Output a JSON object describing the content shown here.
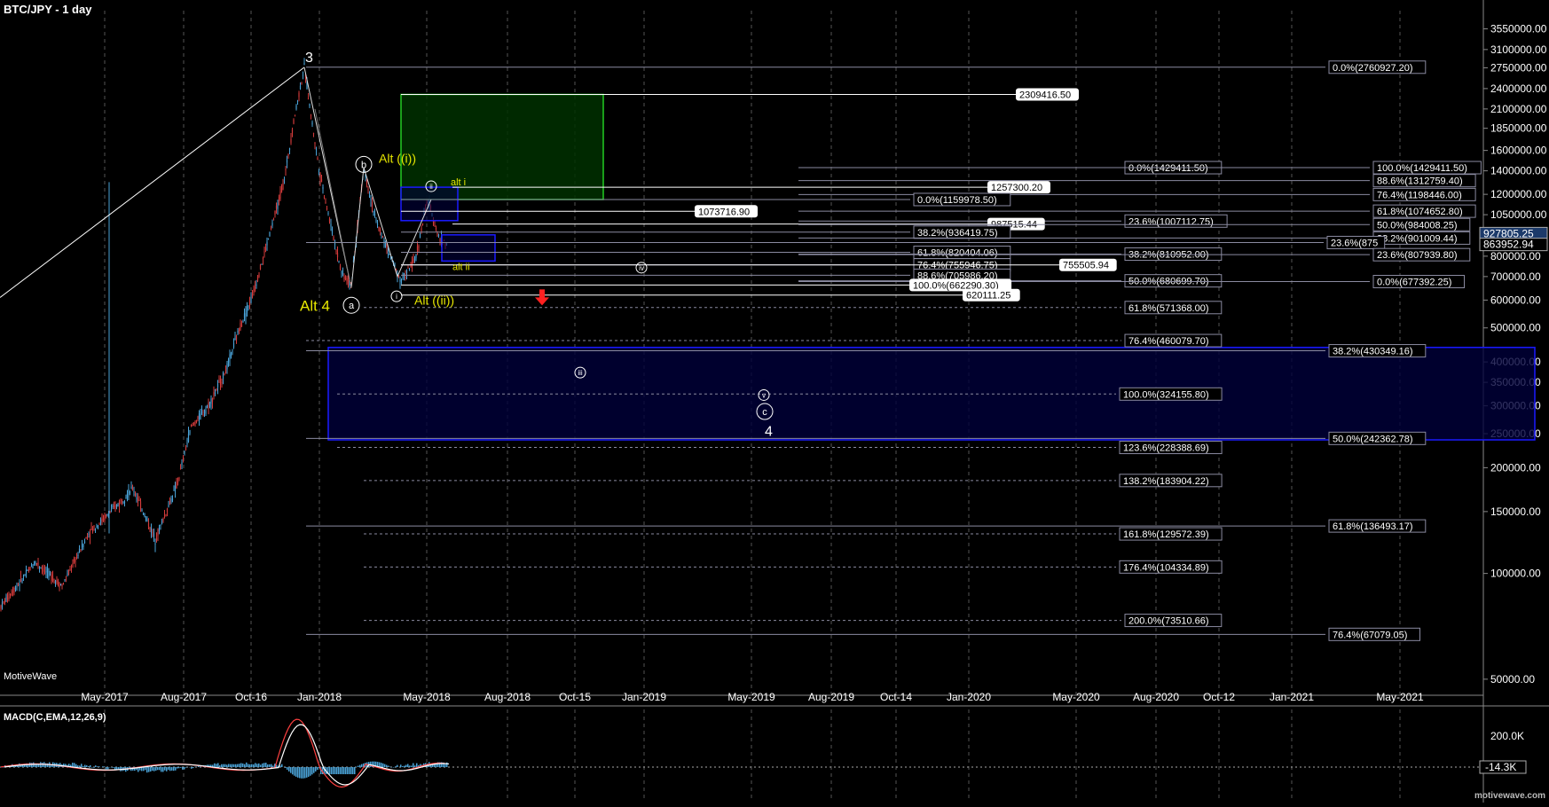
{
  "chart": {
    "title": "BTC/JPY - 1 day",
    "brand": "MotiveWave",
    "brand_footer": "motivewave.com",
    "macd_title": "MACD(C,EMA,12,26,9)",
    "colors": {
      "background": "#000000",
      "grid": "#555555",
      "up": "#4aa3d8",
      "down": "#d43b3b",
      "green_box": "#22cc22",
      "blue_box": "#1a1aff",
      "wave_label": "#ffffff",
      "alt_label": "#e8e800",
      "arrow": "#ff2020"
    }
  },
  "chart_data": {
    "type": "candlestick",
    "y_scale": "log",
    "ylim": [
      45000,
      4000000
    ],
    "x_ticks": [
      "May-2017",
      "Aug-2017",
      "Oct-16",
      "Jan-2018",
      "May-2018",
      "Aug-2018",
      "Oct-15",
      "Jan-2019",
      "May-2019",
      "Aug-2019",
      "Oct-14",
      "Jan-2020",
      "May-2020",
      "Aug-2020",
      "Oct-12",
      "Jan-2021",
      "May-2021"
    ],
    "y_ticks": [
      "3550000.00",
      "3100000.00",
      "2750000.00",
      "2400000.00",
      "2100000.00",
      "1850000.00",
      "1600000.00",
      "1400000.00",
      "1200000.00",
      "1050000.00",
      "800000.00",
      "700000.00",
      "600000.00",
      "500000.00",
      "400000.00",
      "350000.00",
      "300000.00",
      "250000.00",
      "200000.00",
      "150000.00",
      "100000.00",
      "50000.00"
    ],
    "price_labels": [
      "927805.25",
      "863952.94"
    ],
    "level_labels": [
      {
        "text": "0.0%(2760927.20)",
        "value": 2760927.2
      },
      {
        "text": "2309416.50",
        "value": 2309416.5
      },
      {
        "text": "0.0%(1429411.50)",
        "value": 1429411.5
      },
      {
        "text": "100.0%(1429411.50)",
        "value": 1429411.5
      },
      {
        "text": "88.6%(1312759.40)",
        "value": 1312759.4
      },
      {
        "text": "1257300.20",
        "value": 1257300.2
      },
      {
        "text": "76.4%(1198446.00)",
        "value": 1198446.0
      },
      {
        "text": "0.0%(1159978.50)",
        "value": 1159978.5
      },
      {
        "text": "1073716.90",
        "value": 1073716.9
      },
      {
        "text": "61.8%(1074652.80)",
        "value": 1074652.8
      },
      {
        "text": "23.6%(1007112.75)",
        "value": 1007112.75
      },
      {
        "text": "987515.44",
        "value": 987515.44
      },
      {
        "text": "50.0%(984008.25)",
        "value": 984008.25
      },
      {
        "text": "38.2%(936419.75)",
        "value": 936419.75
      },
      {
        "text": "38.2%(901009.44)",
        "value": 901009.44
      },
      {
        "text": "23.6%(875",
        "value": 875000
      },
      {
        "text": "61.8%(820404.06)",
        "value": 820404.06
      },
      {
        "text": "38.2%(810952.00)",
        "value": 810952.0
      },
      {
        "text": "23.6%(807939.80)",
        "value": 807939.8
      },
      {
        "text": "76.4%(755946.75)",
        "value": 755946.75
      },
      {
        "text": "755505.94",
        "value": 755505.94
      },
      {
        "text": "88.6%(705986.20)",
        "value": 705986.2
      },
      {
        "text": "50.0%(680699.70)",
        "value": 680699.7
      },
      {
        "text": "0.0%(677392.25)",
        "value": 677392.25
      },
      {
        "text": "100.0%(662290.30)",
        "value": 662290.3
      },
      {
        "text": "620111.25",
        "value": 620111.25
      },
      {
        "text": "61.8%(571368.00)",
        "value": 571368.0
      },
      {
        "text": "76.4%(460079.70)",
        "value": 460079.7
      },
      {
        "text": "38.2%(430349.16)",
        "value": 430349.16
      },
      {
        "text": "100.0%(324155.80)",
        "value": 324155.8
      },
      {
        "text": "50.0%(242362.78)",
        "value": 242362.78
      },
      {
        "text": "123.6%(228388.69)",
        "value": 228388.69
      },
      {
        "text": "138.2%(183904.22)",
        "value": 183904.22
      },
      {
        "text": "61.8%(136493.17)",
        "value": 136493.17
      },
      {
        "text": "161.8%(129572.39)",
        "value": 129572.39
      },
      {
        "text": "176.4%(104334.89)",
        "value": 104334.89
      },
      {
        "text": "200.0%(73510.66)",
        "value": 73510.66
      },
      {
        "text": "76.4%(67079.05)",
        "value": 67079.05
      }
    ],
    "wave_labels": [
      {
        "text": "3",
        "color": "white"
      },
      {
        "text": "b",
        "circled": true
      },
      {
        "text": "Alt ((i))",
        "color": "yellow"
      },
      {
        "text": "ii",
        "circled": true
      },
      {
        "text": "alt i",
        "color": "yellow"
      },
      {
        "text": "alt ii",
        "color": "yellow"
      },
      {
        "text": "iv",
        "circled": true
      },
      {
        "text": "i",
        "circled": true
      },
      {
        "text": "Alt ((ii))",
        "color": "yellow"
      },
      {
        "text": "Alt 4",
        "color": "yellow"
      },
      {
        "text": "a",
        "circled": true
      },
      {
        "text": "iii",
        "circled": true
      },
      {
        "text": "v",
        "circled": true
      },
      {
        "text": "c",
        "circled": true
      },
      {
        "text": "4",
        "color": "white"
      }
    ],
    "macd": {
      "y_ticks": [
        "200.0K"
      ],
      "value_label": "-14.3K"
    }
  }
}
